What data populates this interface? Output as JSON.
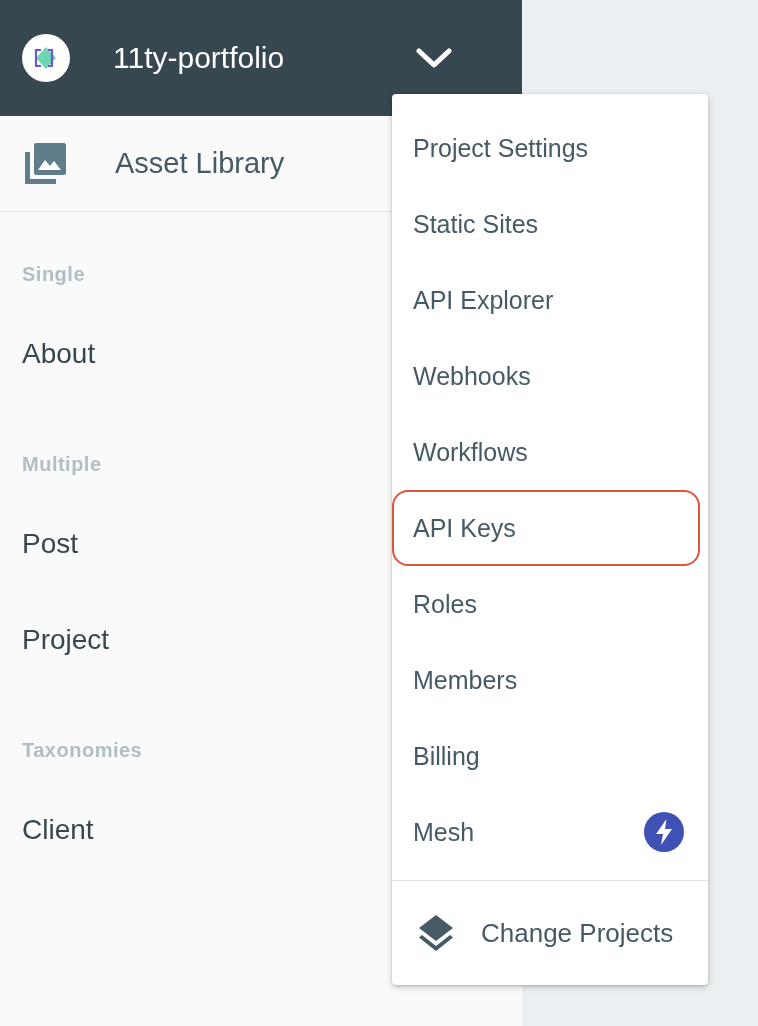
{
  "header": {
    "project_name": "11ty-portfolio"
  },
  "asset_library": {
    "label": "Asset Library"
  },
  "sidebar": {
    "sections": [
      {
        "heading": "Single",
        "items": [
          "About"
        ]
      },
      {
        "heading": "Multiple",
        "items": [
          "Post",
          "Project"
        ]
      },
      {
        "heading": "Taxonomies",
        "items": [
          "Client"
        ]
      }
    ]
  },
  "menu": {
    "items": [
      {
        "label": "Project Settings",
        "kind": "text",
        "highlighted": false
      },
      {
        "label": "Static Sites",
        "kind": "text",
        "highlighted": false
      },
      {
        "label": "API Explorer",
        "kind": "text",
        "highlighted": false
      },
      {
        "label": "Webhooks",
        "kind": "text",
        "highlighted": false
      },
      {
        "label": "Workflows",
        "kind": "text",
        "highlighted": false
      },
      {
        "label": "API Keys",
        "kind": "text",
        "highlighted": true
      },
      {
        "label": "Roles",
        "kind": "text",
        "highlighted": false
      },
      {
        "label": "Members",
        "kind": "text",
        "highlighted": false
      },
      {
        "label": "Billing",
        "kind": "text",
        "highlighted": false
      },
      {
        "label": "Mesh",
        "kind": "bolt",
        "highlighted": false
      }
    ],
    "footer": {
      "label": "Change Projects"
    }
  }
}
